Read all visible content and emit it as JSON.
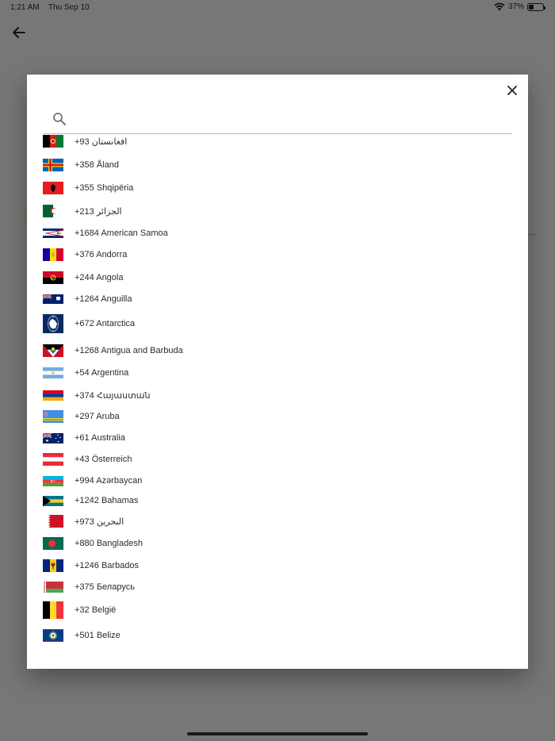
{
  "status_bar": {
    "time": "1:21 AM",
    "date": "Thu Sep 10",
    "battery_text": "37%",
    "battery_level": 0.37
  },
  "dialog": {
    "search_placeholder": "",
    "countries": [
      {
        "text": "+93 افغانستان",
        "flag": "af"
      },
      {
        "text": "+358 Åland",
        "flag": "ax"
      },
      {
        "text": "+355 Shqipëria",
        "flag": "al"
      },
      {
        "text": "+213 الجزائر",
        "flag": "dz"
      },
      {
        "text": "+1684 American Samoa",
        "flag": "as"
      },
      {
        "text": "+376 Andorra",
        "flag": "ad"
      },
      {
        "text": "+244 Angola",
        "flag": "ao"
      },
      {
        "text": "+1264 Anguilla",
        "flag": "ai"
      },
      {
        "text": "+672 Antarctica",
        "flag": "aq"
      },
      {
        "text": "+1268 Antigua and Barbuda",
        "flag": "ag"
      },
      {
        "text": "+54 Argentina",
        "flag": "ar"
      },
      {
        "text": "+374 Հայաստան",
        "flag": "am"
      },
      {
        "text": "+297 Aruba",
        "flag": "aw"
      },
      {
        "text": "+61 Australia",
        "flag": "au"
      },
      {
        "text": "+43 Österreich",
        "flag": "at"
      },
      {
        "text": "+994 Azərbaycan",
        "flag": "az"
      },
      {
        "text": "+1242 Bahamas",
        "flag": "bs"
      },
      {
        "text": "+973 البحرين",
        "flag": "bh"
      },
      {
        "text": "+880 Bangladesh",
        "flag": "bd"
      },
      {
        "text": "+1246 Barbados",
        "flag": "bb"
      },
      {
        "text": "+375 Беларусь",
        "flag": "by"
      },
      {
        "text": "+32 België",
        "flag": "be"
      },
      {
        "text": "+501 Belize",
        "flag": "bz"
      }
    ]
  }
}
